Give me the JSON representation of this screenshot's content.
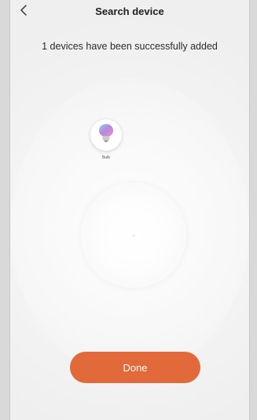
{
  "header": {
    "title": "Search device",
    "back_icon": "chevron-left-icon"
  },
  "status": {
    "message": "1 devices have been successfully added"
  },
  "devices": [
    {
      "name": "Bulb",
      "icon": "light-bulb-icon"
    }
  ],
  "actions": {
    "done_label": "Done"
  },
  "colors": {
    "accent": "#e2693a",
    "background": "#f4f4f4",
    "title_text": "#1e1e1e"
  }
}
